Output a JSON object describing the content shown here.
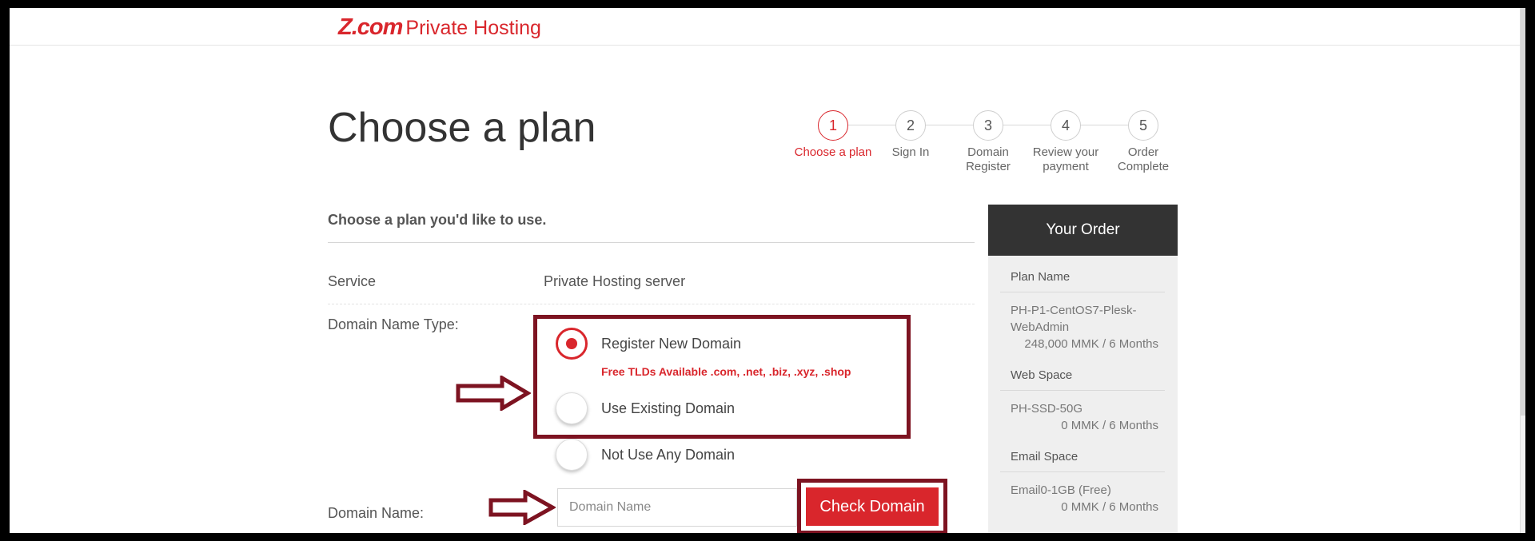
{
  "brand": {
    "mark": "Z.com",
    "name": "Private Hosting"
  },
  "page": {
    "title": "Choose a plan",
    "subtitle": "Choose a plan you'd like to use."
  },
  "steps": [
    {
      "number": "1",
      "label": "Choose a plan",
      "active": true
    },
    {
      "number": "2",
      "label": "Sign In"
    },
    {
      "number": "3",
      "label": "Domain Register"
    },
    {
      "number": "4",
      "label": "Review your payment"
    },
    {
      "number": "5",
      "label": "Order Complete"
    }
  ],
  "form": {
    "service_label": "Service",
    "service_value": "Private Hosting server",
    "domain_type_label": "Domain Name Type:",
    "options": [
      {
        "label": "Register New Domain",
        "checked": true
      },
      {
        "label": "Use Existing Domain",
        "checked": false
      },
      {
        "label": "Not Use Any Domain",
        "checked": false
      }
    ],
    "free_tld_note": "Free TLDs Available .com, .net, .biz, .xyz, .shop",
    "domain_name_label": "Domain Name:",
    "domain_name_placeholder": "Domain Name",
    "domain_name_value": "",
    "check_button": "Check Domain"
  },
  "order": {
    "title": "Your Order",
    "plan_name_title": "Plan Name",
    "plan_name_value": "PH-P1-CentOS7-Plesk-WebAdmin",
    "plan_price": "248,000 MMK / 6 Months",
    "web_space_title": "Web Space",
    "web_space_value": "PH-SSD-50G",
    "web_space_price": "0 MMK / 6 Months",
    "email_space_title": "Email Space",
    "email_space_value": "Email0-1GB (Free)",
    "email_space_price": "0 MMK / 6 Months"
  },
  "colors": {
    "accent": "#d9262c",
    "annotation": "#7d1321",
    "order_header": "#333333"
  }
}
